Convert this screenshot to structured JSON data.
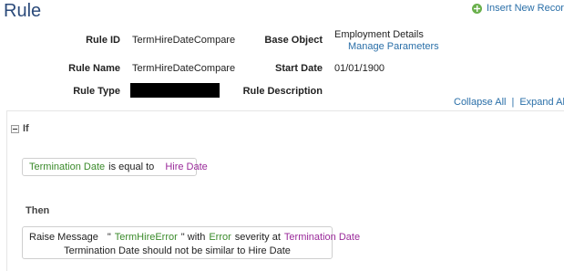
{
  "page": {
    "title": "Rule"
  },
  "toolbar": {
    "insert_label": "Insert New Record",
    "insert_icon": "plus-circle-icon",
    "insert_icon_color": "#6ab04c"
  },
  "fields": {
    "rule_id": {
      "label": "Rule ID",
      "value": "TermHireDateCompare"
    },
    "base_object": {
      "label": "Base Object",
      "value": "Employment Details",
      "link": "Manage Parameters"
    },
    "rule_name": {
      "label": "Rule Name",
      "value": "TermHireDateCompare"
    },
    "start_date": {
      "label": "Start Date",
      "value": "01/01/1900"
    },
    "rule_type": {
      "label": "Rule Type",
      "value": ""
    },
    "rule_description": {
      "label": "Rule Description",
      "value": ""
    }
  },
  "controls": {
    "collapse_all": "Collapse All",
    "separator": "|",
    "expand_all": "Expand All"
  },
  "if_block": {
    "label": "If",
    "condition": {
      "left": "Termination Date",
      "operator": "is equal to",
      "right": "Hire Date"
    }
  },
  "then_block": {
    "label": "Then",
    "action": {
      "verb": "Raise Message",
      "quote_open": "\"",
      "message_key": "TermHireError",
      "quote_close": "\" with",
      "severity": "Error",
      "severity_suffix": "severity at",
      "target": "Termination Date",
      "message_text": "Termination Date should not be similar to Hire Date"
    }
  },
  "colors": {
    "link": "#2a6fa8",
    "title": "#2b4a7a",
    "field_green": "#3a8a2a",
    "field_purple": "#9a2a9a"
  }
}
